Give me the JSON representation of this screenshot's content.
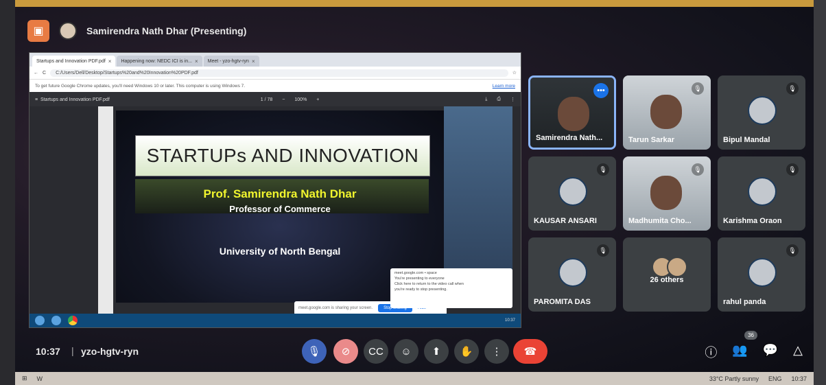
{
  "presenter": {
    "name": "Samirendra Nath Dhar (Presenting)"
  },
  "shared_screen": {
    "tabs": [
      {
        "label": "Startups and Innovation PDF.pdf"
      },
      {
        "label": "Happening now: NEDC ICI is in..."
      },
      {
        "label": "Meet - yzo-hgtv-ryn"
      }
    ],
    "address": "C:/Users/Dell/Desktop/Startups%20and%20Innovation%20PDF.pdf",
    "notice": "To get future Google Chrome updates, you'll need Windows 10 or later. This computer is using Windows 7.",
    "learn_more": "Learn more",
    "pdf_title": "Startups and Innovation PDF.pdf",
    "page_info": "1 / 78",
    "zoom": "100%",
    "slide": {
      "title": "STARTUPs AND INNOVATION",
      "author": "Prof. Samirendra Nath Dhar",
      "role": "Professor of Commerce",
      "university": "University of North  Bengal"
    },
    "sharing_text": "meet.google.com is sharing your screen.",
    "stop_sharing": "Stop sharing",
    "hide": "Hide",
    "popup": {
      "line1": "meet.google.com • space",
      "line2": "You're presenting to everyone",
      "line3": "Click here to return to the video call when",
      "line4": "you're ready to stop presenting."
    }
  },
  "participants": [
    {
      "name": "Samirendra Nath...",
      "type": "camera",
      "active": true
    },
    {
      "name": "Tarun Sarkar",
      "type": "camera"
    },
    {
      "name": "Bipul Mandal",
      "type": "avatar"
    },
    {
      "name": "KAUSAR ANSARI",
      "type": "avatar"
    },
    {
      "name": "Madhumita Cho...",
      "type": "camera"
    },
    {
      "name": "Karishma Oraon",
      "type": "avatar"
    },
    {
      "name": "PAROMITA DAS",
      "type": "avatar"
    },
    {
      "name": "26 others",
      "type": "group"
    },
    {
      "name": "rahul panda",
      "type": "avatar"
    }
  ],
  "bottom_bar": {
    "time": "10:37",
    "separator": "|",
    "meeting_code": "yzo-hgtv-ryn",
    "people_count": "36"
  },
  "win_taskbar": {
    "weather": "33°C  Partly sunny",
    "lang": "ENG",
    "clock": "10:37"
  }
}
